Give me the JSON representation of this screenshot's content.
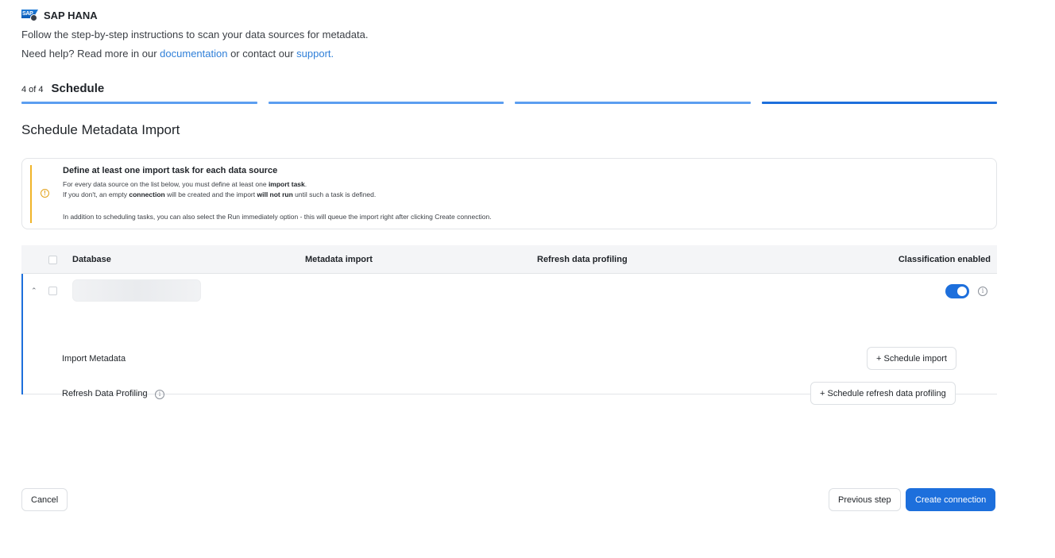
{
  "header": {
    "logo_text": "SAP",
    "app_name": "SAP HANA",
    "intro": "Follow the step-by-step instructions to scan your data sources for metadata.",
    "help_prefix": "Need help? Read more in our ",
    "help_doc_link": "documentation",
    "help_middle": " or contact our ",
    "help_support_link": "support."
  },
  "step": {
    "count": "4 of 4",
    "title": "Schedule",
    "progress_segments": 4,
    "current": 4
  },
  "section_title": "Schedule Metadata Import",
  "notice": {
    "title": "Define at least one import task for each data source",
    "line1_a": "For every data source on the list below, you must define at least one ",
    "line1_b": "import task",
    "line1_c": ".",
    "line2_a": "If you don't, an empty ",
    "line2_b": "connection",
    "line2_c": " will be created and the import ",
    "line2_d": "will not run",
    "line2_e": " until such a task is defined.",
    "line3": "In addition to scheduling tasks, you can also select the Run immediately option - this will queue the import right after clicking Create connection."
  },
  "table": {
    "col_database": "Database",
    "col_metadata_import": "Metadata import",
    "col_refresh_profiling": "Refresh data profiling",
    "col_classification": "Classification enabled",
    "row": {
      "classification_enabled": true,
      "import_metadata_label": "Import Metadata",
      "refresh_profiling_label": "Refresh Data Profiling",
      "schedule_import_button": "+ Schedule import",
      "schedule_refresh_button": "+ Schedule refresh data profiling"
    }
  },
  "footer": {
    "cancel": "Cancel",
    "previous": "Previous step",
    "create": "Create connection"
  },
  "colors": {
    "accent": "#1d6fdc",
    "warning": "#f0b429",
    "link": "#2f7fd8"
  }
}
